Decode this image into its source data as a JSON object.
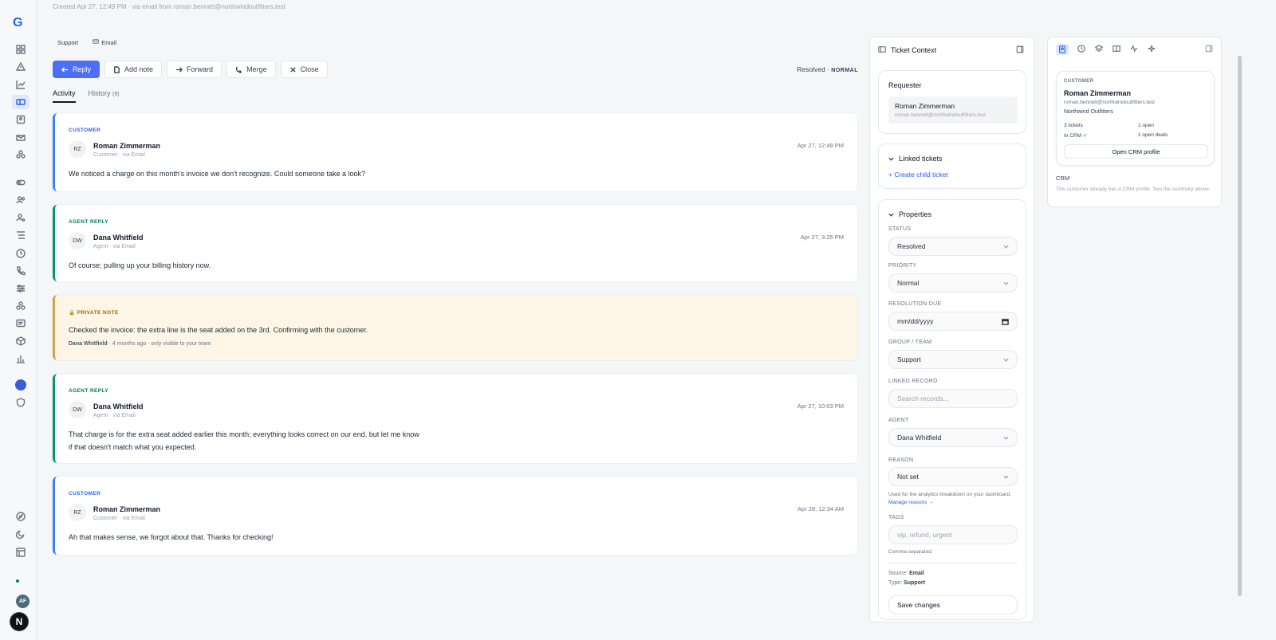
{
  "brand": {
    "logo": "G"
  },
  "header": {
    "created_line": "Created Apr 27, 12:49 PM · via email from roman.bennett@northwindoutfitters.test"
  },
  "tags": {
    "group": "Support",
    "channel": "Email"
  },
  "toolbar": {
    "reply": "Reply",
    "add_note": "Add note",
    "forward": "Forward",
    "merge": "Merge",
    "close": "Close"
  },
  "status": {
    "state": "Resolved",
    "sep": "·",
    "priority": "NORMAL"
  },
  "tabs": {
    "activity": "Activity",
    "history": "History",
    "history_count": "(9)"
  },
  "messages": [
    {
      "kind": "CUSTOMER",
      "initials": "RZ",
      "name": "Roman Zimmerman",
      "sub": "Customer · via Email",
      "time": "Apr 27, 12:49 PM",
      "body": "We noticed a charge on this month's invoice we don't recognize. Could someone take a look?"
    },
    {
      "kind": "AGENT REPLY",
      "initials": "DW",
      "name": "Dana Whitfield",
      "sub": "Agent · via Email",
      "time": "Apr 27, 3:25 PM",
      "body": "Of course; pulling up your billing history now."
    },
    {
      "kind": "PRIVATE NOTE",
      "body": "Checked the invoice: the extra line is the seat added on the 3rd. Confirming with the customer.",
      "author": "Dana Whitfield",
      "meta": " · 4 months ago · only visible to your team"
    },
    {
      "kind": "AGENT REPLY",
      "initials": "DW",
      "name": "Dana Whitfield",
      "sub": "Agent · via Email",
      "time": "Apr 27, 10:03 PM",
      "body": "That charge is for the extra seat added earlier this month; everything looks correct on our end, but let me know if that doesn't match what you expected."
    },
    {
      "kind": "CUSTOMER",
      "initials": "RZ",
      "name": "Roman Zimmerman",
      "sub": "Customer · via Email",
      "time": "Apr 28, 12:34 AM",
      "body": "Ah that makes sense, we forgot about that. Thanks for checking!"
    }
  ],
  "context": {
    "title": "Ticket Context",
    "requester": {
      "title": "Requester",
      "name": "Roman Zimmerman",
      "email": "roman.bennett@northwindoutfitters.test"
    },
    "linked": {
      "title": "Linked tickets",
      "create": "+ Create child ticket"
    },
    "properties": {
      "title": "Properties",
      "status_label": "STATUS",
      "status": "Resolved",
      "priority_label": "PRIORITY",
      "priority": "Normal",
      "due_label": "RESOLUTION DUE",
      "due": "mm/dd/yyyy",
      "group_label": "GROUP / TEAM",
      "group": "Support",
      "linked_label": "LINKED RECORD",
      "linked_placeholder": "Search records...",
      "agent_label": "AGENT",
      "agent": "Dana Whitfield",
      "reason_label": "REASON",
      "reason": "Not set",
      "reason_help": "Used for the analytics breakdown on your dashboard.",
      "manage_reasons": "Manage reasons →",
      "tags_label": "TAGS",
      "tags_placeholder": "vip, refund, urgent",
      "tags_help": "Comma-separated.",
      "source_label": "Source:",
      "source": "Email",
      "type_label": "Type:",
      "type": "Support",
      "save": "Save changes"
    }
  },
  "crm": {
    "kind": "CUSTOMER",
    "name": "Roman Zimmerman",
    "email": "roman.bennett@northwindoutfitters.test",
    "company": "Northwind Outfitters",
    "tickets": "3 tickets",
    "open": "1 open",
    "in_crm": "In CRM ✓",
    "deals": "1 open deals",
    "open_profile": "Open CRM profile",
    "label": "CRM",
    "desc": "This customer already has a CRM profile. See the summary above."
  },
  "colors": {
    "accent": "#4f6ef7",
    "customer": "#3b82f6",
    "agent": "#059669",
    "note": "#d4a24c"
  }
}
